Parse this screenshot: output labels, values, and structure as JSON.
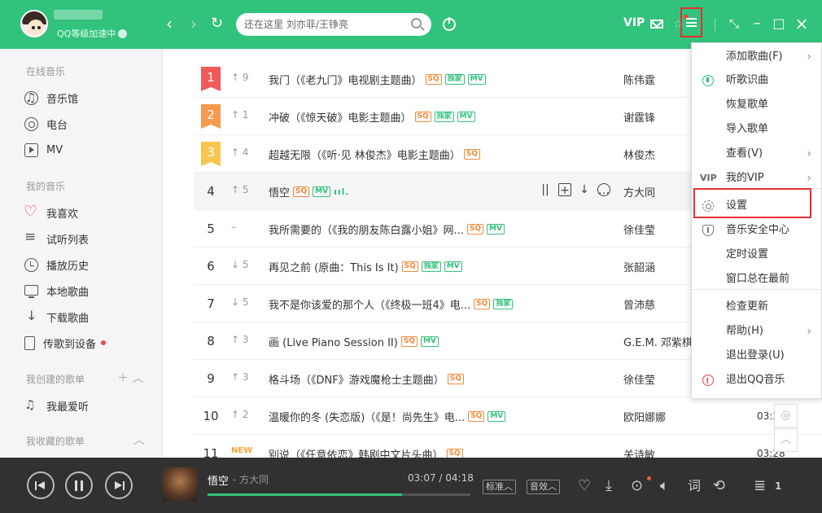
{
  "header": {
    "user_level": "QQ等级加速中",
    "search_placeholder": "还在这里 刘亦菲/王铮亮",
    "vip_label": "VIP"
  },
  "sidebar": {
    "groups": {
      "online": "在线音乐",
      "my": "我的音乐",
      "created": "我创建的歌单",
      "collected": "我收藏的歌单"
    },
    "online_items": [
      "音乐馆",
      "电台",
      "MV"
    ],
    "my_items": [
      "我喜欢",
      "试听列表",
      "播放历史",
      "本地歌曲",
      "下载歌曲",
      "传歌到设备"
    ],
    "created_items": [
      "我最爱听"
    ]
  },
  "songs": [
    {
      "rank": "1",
      "trend": "9",
      "title": "我门（《老九门》电视剧主题曲）",
      "badges": [
        "SQ",
        "独家",
        "MV"
      ],
      "singer": "陈伟霆"
    },
    {
      "rank": "2",
      "trend": "1",
      "title": "冲破（《惊天破》电影主题曲）",
      "badges": [
        "SQ",
        "独家",
        "MV"
      ],
      "singer": "谢霆锋"
    },
    {
      "rank": "3",
      "trend": "4",
      "title": "超越无限（《听·见 林俊杰》电影主题曲）",
      "badges": [
        "SQ"
      ],
      "singer": "林俊杰"
    },
    {
      "rank": "4",
      "trend": "5",
      "title": "悟空",
      "badges": [
        "SQ",
        "MV"
      ],
      "singer": "方大同"
    },
    {
      "rank": "5",
      "trend": "–",
      "title": "我所需要的（《我的朋友陈白露小姐》网...",
      "badges": [
        "SQ",
        "MV"
      ],
      "singer": "徐佳莹"
    },
    {
      "rank": "6",
      "trend": "5",
      "title": "再见之前 (原曲：This Is It)",
      "badges": [
        "SQ",
        "独家",
        "MV"
      ],
      "singer": "张韶涵"
    },
    {
      "rank": "7",
      "trend": "5",
      "title": "我不是你该爱的那个人（《终极一班4》电...",
      "badges": [
        "SQ",
        "独家"
      ],
      "singer": "曾沛慈"
    },
    {
      "rank": "8",
      "trend": "3",
      "title": "画 (Live Piano Session II)",
      "badges": [
        "SQ",
        "MV"
      ],
      "singer": "G.E.M. 邓紫棋"
    },
    {
      "rank": "9",
      "trend": "3",
      "title": "格斗场（《DNF》游戏魔枪士主题曲）",
      "badges": [
        "SQ"
      ],
      "singer": "徐佳莹"
    },
    {
      "rank": "10",
      "trend": "2",
      "title": "温暖你的冬 (失恋版)（《是！尚先生》电...",
      "badges": [
        "SQ",
        "MV"
      ],
      "singer": "欧阳娜娜",
      "duration": "03:2"
    },
    {
      "rank": "11",
      "trend": "NEW",
      "title": "别说（《任意依恋》韩剧中文片头曲）",
      "badges": [
        "SQ"
      ],
      "singer": "关诗敏",
      "duration": "03:28"
    }
  ],
  "row_icons": {
    "eq": "ııl."
  },
  "menu": [
    {
      "label": "添加歌曲(F)",
      "arrow": true
    },
    {
      "label": "听歌识曲",
      "icon": "music-recognition-icon"
    },
    {
      "label": "恢复歌单"
    },
    {
      "label": "导入歌单"
    },
    {
      "label": "查看(V)",
      "arrow": true
    },
    {
      "label": "我的VIP",
      "arrow": true,
      "prefix": "VIP"
    },
    {
      "label": "设置",
      "icon": "gear-icon"
    },
    {
      "label": "音乐安全中心",
      "icon": "shield-icon"
    },
    {
      "label": "定时设置"
    },
    {
      "label": "窗口总在最前"
    },
    {
      "label": "检查更新"
    },
    {
      "label": "帮助(H)",
      "arrow": true
    },
    {
      "label": "退出登录(U)"
    },
    {
      "label": "退出QQ音乐",
      "icon": "exit-icon"
    }
  ],
  "player": {
    "title": "悟空",
    "singer": "- 方大同",
    "time": "03:07 / 04:18",
    "progress": 0.74,
    "quality": "标准",
    "effect": "音效",
    "queue_count": "1"
  },
  "colors": {
    "brand": "#31c27c",
    "highlight": "#e63030"
  }
}
